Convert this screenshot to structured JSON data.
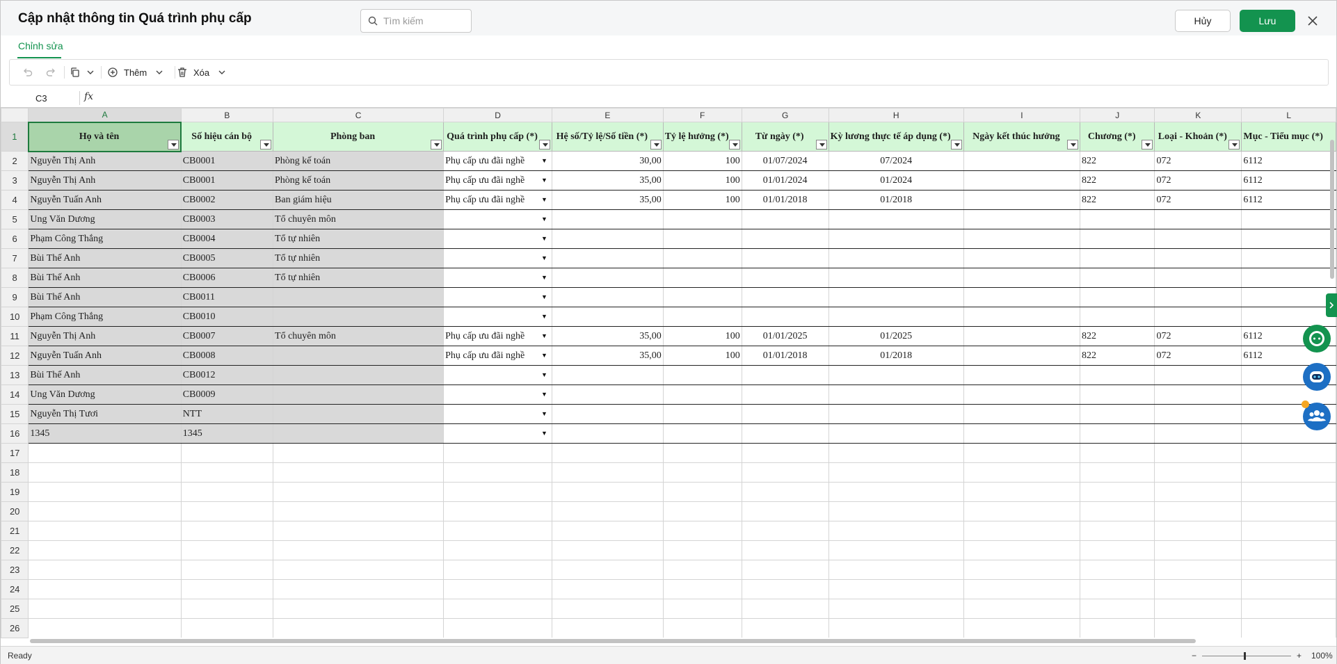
{
  "header": {
    "title": "Cập nhật thông tin Quá trình phụ cấp",
    "search_placeholder": "Tìm kiếm",
    "cancel_label": "Hủy",
    "save_label": "Lưu"
  },
  "tabs": {
    "edit_label": "Chỉnh sửa"
  },
  "toolbar": {
    "add_label": "Thêm",
    "delete_label": "Xóa"
  },
  "formula_bar": {
    "cell_ref": "C3",
    "fx_label": "fx",
    "content": ""
  },
  "sheet": {
    "columns": [
      "A",
      "B",
      "C",
      "D",
      "E",
      "F",
      "G",
      "H",
      "I",
      "J",
      "K",
      "L"
    ],
    "headers": [
      "Họ và tên",
      "Số hiệu cán bộ",
      "Phòng ban",
      "Quá trình phụ cấp (*)",
      "Hệ số/Tỷ lệ/Số tiền (*)",
      "Tỷ lệ hưởng (*)",
      "Từ ngày (*)",
      "Kỳ lương thực tế áp dụng (*)",
      "Ngày kết thúc hưởng",
      "Chương (*)",
      "Loại - Khoản (*)",
      "Mục - Tiểu mục (*)"
    ],
    "rows": [
      {
        "n": "2",
        "a": "Nguyễn Thị Anh",
        "b": "CB0001",
        "c": "Phòng kế toán",
        "d": "Phụ cấp ưu đãi nghề",
        "e": "30,00",
        "f": "100",
        "g": "01/07/2024",
        "h": "07/2024",
        "i": "",
        "j": "822",
        "k": "072",
        "l": "6112"
      },
      {
        "n": "3",
        "a": "Nguyễn Thị Anh",
        "b": "CB0001",
        "c": "Phòng kế toán",
        "d": "Phụ cấp ưu đãi nghề",
        "e": "35,00",
        "f": "100",
        "g": "01/01/2024",
        "h": "01/2024",
        "i": "",
        "j": "822",
        "k": "072",
        "l": "6112"
      },
      {
        "n": "4",
        "a": "Nguyễn Tuấn Anh",
        "b": "CB0002",
        "c": "Ban giám hiệu",
        "d": "Phụ cấp ưu đãi nghề",
        "e": "35,00",
        "f": "100",
        "g": "01/01/2018",
        "h": "01/2018",
        "i": "",
        "j": "822",
        "k": "072",
        "l": "6112"
      },
      {
        "n": "5",
        "a": "Ung Văn Dương",
        "b": "CB0003",
        "c": "Tổ chuyên môn",
        "d": "",
        "e": "",
        "f": "",
        "g": "",
        "h": "",
        "i": "",
        "j": "",
        "k": "",
        "l": ""
      },
      {
        "n": "6",
        "a": "Phạm Công Thắng",
        "b": "CB0004",
        "c": "Tổ tự nhiên",
        "d": "",
        "e": "",
        "f": "",
        "g": "",
        "h": "",
        "i": "",
        "j": "",
        "k": "",
        "l": ""
      },
      {
        "n": "7",
        "a": "Bùi Thế Anh",
        "b": "CB0005",
        "c": "Tổ tự nhiên",
        "d": "",
        "e": "",
        "f": "",
        "g": "",
        "h": "",
        "i": "",
        "j": "",
        "k": "",
        "l": ""
      },
      {
        "n": "8",
        "a": "Bùi Thế Anh",
        "b": "CB0006",
        "c": "Tổ tự nhiên",
        "d": "",
        "e": "",
        "f": "",
        "g": "",
        "h": "",
        "i": "",
        "j": "",
        "k": "",
        "l": ""
      },
      {
        "n": "9",
        "a": "Bùi Thế Anh",
        "b": "CB0011",
        "c": "",
        "d": "",
        "e": "",
        "f": "",
        "g": "",
        "h": "",
        "i": "",
        "j": "",
        "k": "",
        "l": ""
      },
      {
        "n": "10",
        "a": "Phạm Công Thắng",
        "b": "CB0010",
        "c": "",
        "d": "",
        "e": "",
        "f": "",
        "g": "",
        "h": "",
        "i": "",
        "j": "",
        "k": "",
        "l": ""
      },
      {
        "n": "11",
        "a": "Nguyễn Thị Anh",
        "b": "CB0007",
        "c": "Tổ chuyên môn",
        "d": "Phụ cấp ưu đãi nghề",
        "e": "35,00",
        "f": "100",
        "g": "01/01/2025",
        "h": "01/2025",
        "i": "",
        "j": "822",
        "k": "072",
        "l": "6112"
      },
      {
        "n": "12",
        "a": "Nguyễn Tuấn Anh",
        "b": "CB0008",
        "c": "",
        "d": "Phụ cấp ưu đãi nghề",
        "e": "35,00",
        "f": "100",
        "g": "01/01/2018",
        "h": "01/2018",
        "i": "",
        "j": "822",
        "k": "072",
        "l": "6112"
      },
      {
        "n": "13",
        "a": "Bùi Thế Anh",
        "b": "CB0012",
        "c": "",
        "d": "",
        "e": "",
        "f": "",
        "g": "",
        "h": "",
        "i": "",
        "j": "",
        "k": "",
        "l": ""
      },
      {
        "n": "14",
        "a": "Ung Văn Dương",
        "b": "CB0009",
        "c": "",
        "d": "",
        "e": "",
        "f": "",
        "g": "",
        "h": "",
        "i": "",
        "j": "",
        "k": "",
        "l": ""
      },
      {
        "n": "15",
        "a": "Nguyễn Thị Tươi",
        "b": "NTT",
        "c": "",
        "d": "",
        "e": "",
        "f": "",
        "g": "",
        "h": "",
        "i": "",
        "j": "",
        "k": "",
        "l": ""
      },
      {
        "n": "16",
        "a": "1345",
        "b": "1345",
        "c": "",
        "d": "",
        "e": "",
        "f": "",
        "g": "",
        "h": "",
        "i": "",
        "j": "",
        "k": "",
        "l": ""
      }
    ],
    "empty_rows": [
      "17",
      "18",
      "19",
      "20",
      "21",
      "22",
      "23",
      "24",
      "25",
      "26"
    ]
  },
  "status": {
    "text": "Ready",
    "zoom": "100%",
    "zoom_minus": "−",
    "zoom_plus": "+"
  },
  "colors": {
    "accent": "#13934f",
    "header_fill": "#d4f7d7",
    "selected_header_fill": "#a9d4aa",
    "locked_cell_fill": "#d9d9d9"
  },
  "icons": {
    "search": "search-icon",
    "close": "close-icon",
    "undo": "undo-icon",
    "redo": "redo-icon",
    "copy": "copy-icon",
    "add": "plus-circle-icon",
    "delete": "trash-icon",
    "dropdown": "chevron-down-icon",
    "side_panel": "chevron-right-icon",
    "chat": "chat-icon",
    "bot": "bot-icon",
    "community": "people-icon"
  }
}
